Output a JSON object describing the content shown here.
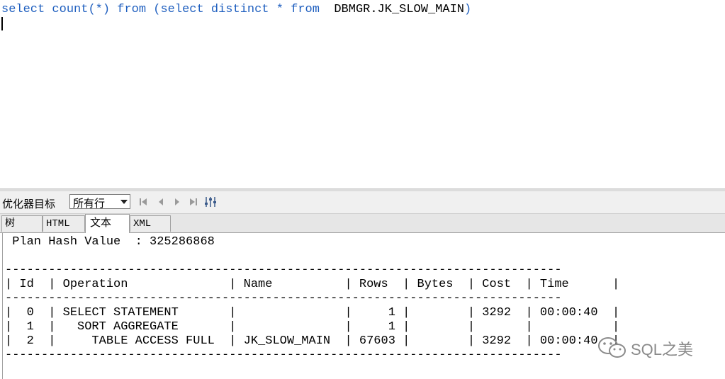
{
  "editor": {
    "tokens": [
      {
        "text": "select",
        "kind": "kw"
      },
      {
        "text": " ",
        "kind": "ob"
      },
      {
        "text": "count",
        "kind": "kw"
      },
      {
        "text": "(*)",
        "kind": "pn"
      },
      {
        "text": " ",
        "kind": "ob"
      },
      {
        "text": "from",
        "kind": "kw"
      },
      {
        "text": " ",
        "kind": "ob"
      },
      {
        "text": "(",
        "kind": "pn"
      },
      {
        "text": "select",
        "kind": "kw"
      },
      {
        "text": " ",
        "kind": "ob"
      },
      {
        "text": "distinct",
        "kind": "kw"
      },
      {
        "text": " ",
        "kind": "ob"
      },
      {
        "text": "*",
        "kind": "pn"
      },
      {
        "text": " ",
        "kind": "ob"
      },
      {
        "text": "from",
        "kind": "kw"
      },
      {
        "text": "  ",
        "kind": "ob"
      },
      {
        "text": "DBMGR.JK_SLOW_MAIN",
        "kind": "ob"
      },
      {
        "text": ")",
        "kind": "pn"
      }
    ]
  },
  "toolbar": {
    "optimizer_label": "优化器目标",
    "select_value": "所有行",
    "first_icon": "first-record-icon",
    "prev_icon": "prev-record-icon",
    "next_icon": "next-record-icon",
    "last_icon": "last-record-icon",
    "adjust_icon": "sliders-icon"
  },
  "tabs": [
    {
      "label": "树"
    },
    {
      "label": "HTML"
    },
    {
      "label": "文本"
    },
    {
      "label": "XML"
    }
  ],
  "output": {
    "text": " Plan Hash Value  : 325286868\n\n-----------------------------------------------------------------------------\n| Id  | Operation              | Name          | Rows  | Bytes  | Cost  | Time      |\n-----------------------------------------------------------------------------\n|  0  | SELECT STATEMENT       |               |     1 |        | 3292  | 00:00:40  |\n|  1  |   SORT AGGREGATE       |               |     1 |        |       |           |\n|  2  |     TABLE ACCESS FULL  | JK_SLOW_MAIN  | 67603 |        | 3292  | 00:00:40  |\n-----------------------------------------------------------------------------"
  },
  "watermark": {
    "text": "SQL之美",
    "icon": "wechat-icon"
  }
}
